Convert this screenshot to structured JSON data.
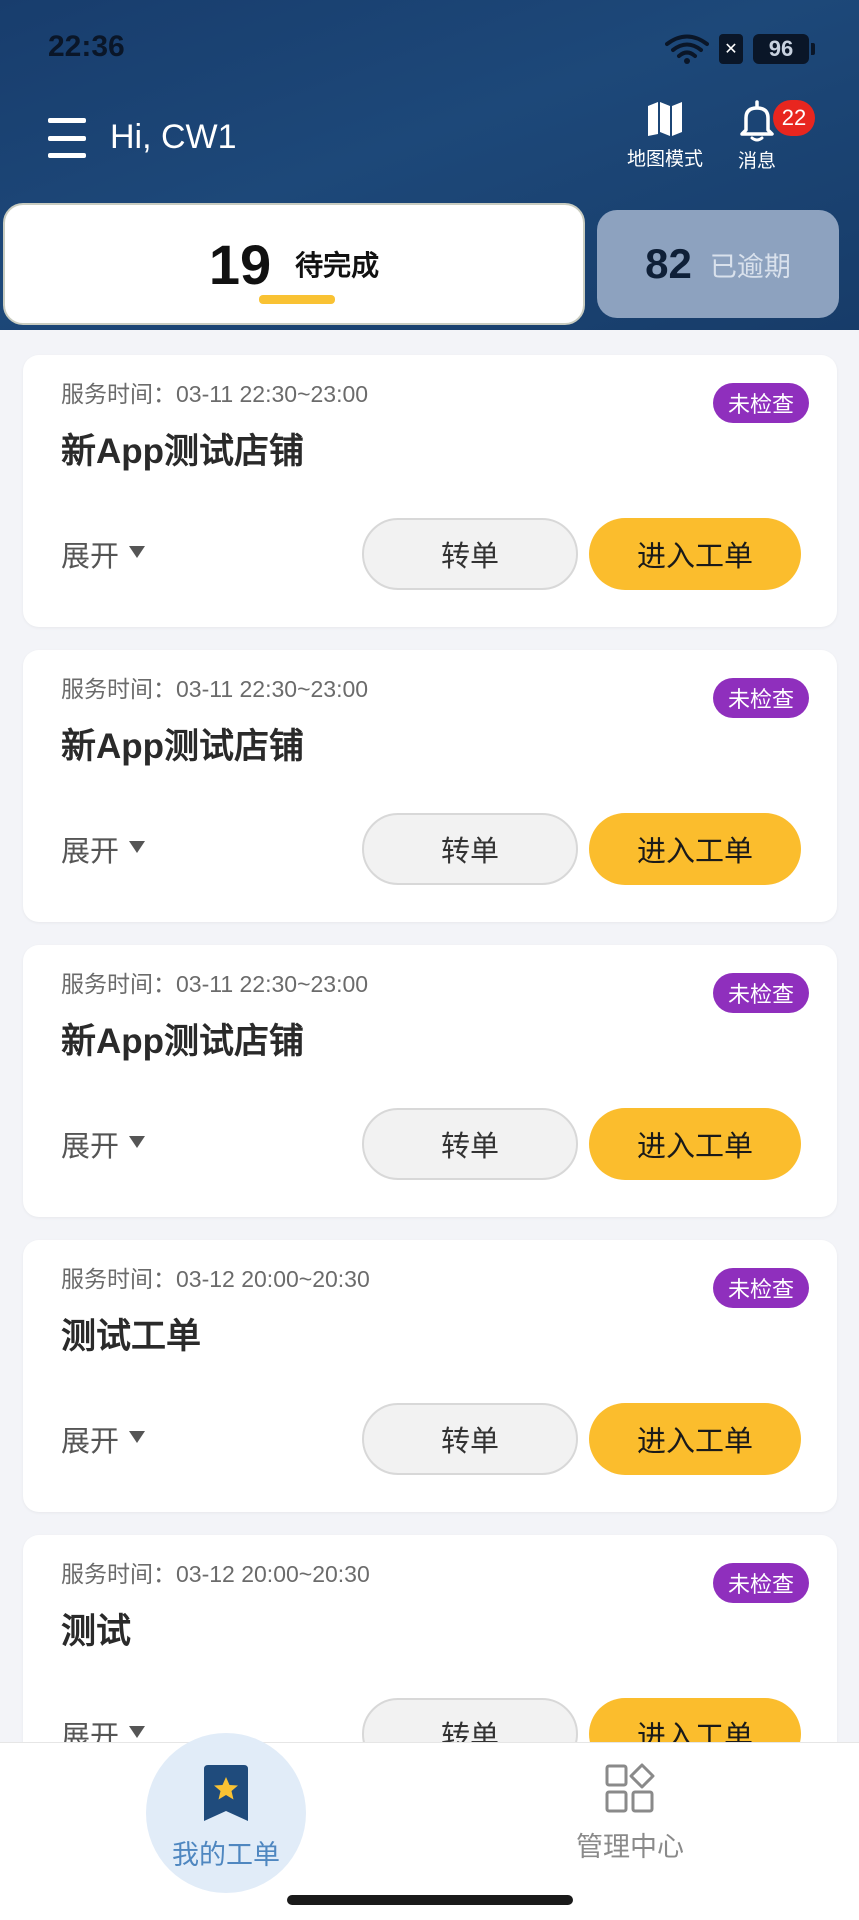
{
  "status_bar": {
    "time": "22:36",
    "sim_label": "✕",
    "battery": "96"
  },
  "header": {
    "greeting": "Hi, CW1",
    "map_mode_label": "地图模式",
    "messages_label": "消息",
    "messages_badge": "22"
  },
  "tabs": {
    "pending": {
      "count": "19",
      "label": "待完成"
    },
    "overdue": {
      "count": "82",
      "label": "已逾期"
    }
  },
  "cards": [
    {
      "service_time": "服务时间：03-11 22:30~23:00",
      "title": "新App测试店铺",
      "status": "未检查",
      "expand_label": "展开",
      "transfer_label": "转单",
      "enter_label": "进入工单"
    },
    {
      "service_time": "服务时间：03-11 22:30~23:00",
      "title": "新App测试店铺",
      "status": "未检查",
      "expand_label": "展开",
      "transfer_label": "转单",
      "enter_label": "进入工单"
    },
    {
      "service_time": "服务时间：03-11 22:30~23:00",
      "title": "新App测试店铺",
      "status": "未检查",
      "expand_label": "展开",
      "transfer_label": "转单",
      "enter_label": "进入工单"
    },
    {
      "service_time": "服务时间：03-12 20:00~20:30",
      "title": "测试工单",
      "status": "未检查",
      "expand_label": "展开",
      "transfer_label": "转单",
      "enter_label": "进入工单"
    },
    {
      "service_time": "服务时间：03-12 20:00~20:30",
      "title": "测试",
      "status": "未检查",
      "expand_label": "展开",
      "transfer_label": "转单",
      "enter_label": "进入工单"
    }
  ],
  "bottom_nav": {
    "orders_label": "我的工单",
    "admin_label": "管理中心"
  },
  "colors": {
    "header": "#1d4879",
    "accent_yellow": "#fbbd2d",
    "status_purple": "#8f2fbd",
    "badge_red": "#e8261f",
    "nav_active": "#4f87c0"
  }
}
